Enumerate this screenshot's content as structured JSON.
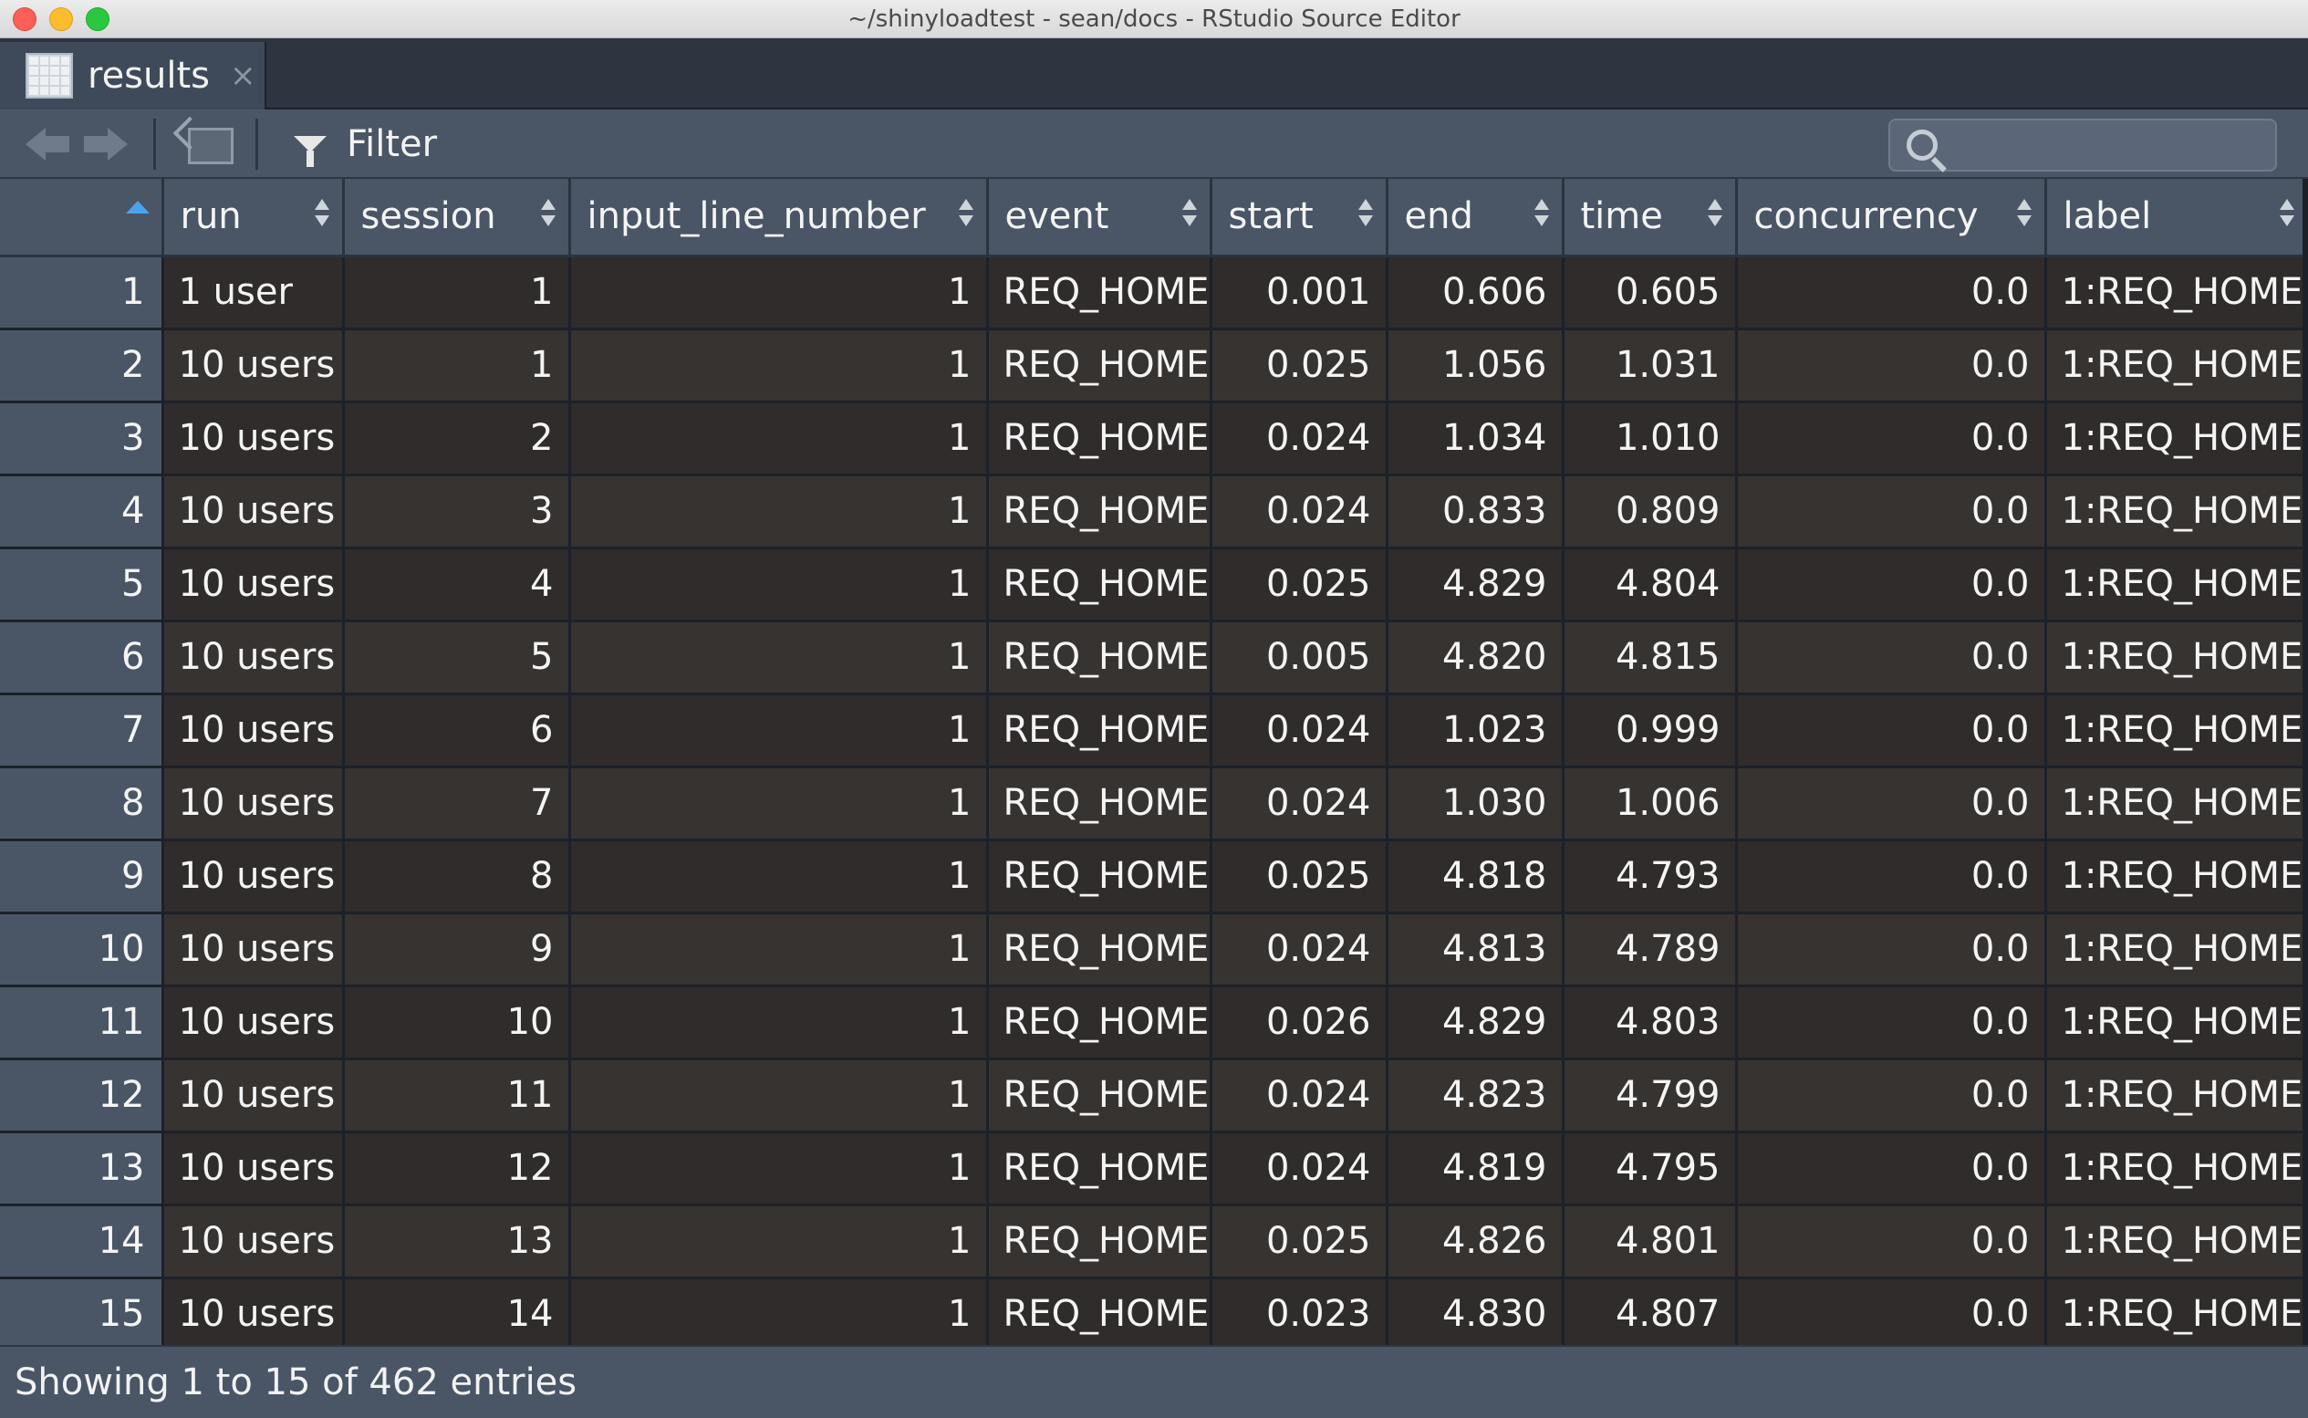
{
  "window": {
    "title": "~/shinyloadtest - sean/docs - RStudio Source Editor"
  },
  "tab": {
    "label": "results",
    "close": "×"
  },
  "toolbar": {
    "filter_label": "Filter",
    "search_placeholder": ""
  },
  "table": {
    "columns": [
      "run",
      "session",
      "input_line_number",
      "event",
      "start",
      "end",
      "time",
      "concurrency",
      "label"
    ],
    "rows": [
      [
        "1",
        "1 user",
        "1",
        "1",
        "REQ_HOME",
        "0.001",
        "0.606",
        "0.605",
        "0.0",
        "1:REQ_HOME"
      ],
      [
        "2",
        "10 users",
        "1",
        "1",
        "REQ_HOME",
        "0.025",
        "1.056",
        "1.031",
        "0.0",
        "1:REQ_HOME"
      ],
      [
        "3",
        "10 users",
        "2",
        "1",
        "REQ_HOME",
        "0.024",
        "1.034",
        "1.010",
        "0.0",
        "1:REQ_HOME"
      ],
      [
        "4",
        "10 users",
        "3",
        "1",
        "REQ_HOME",
        "0.024",
        "0.833",
        "0.809",
        "0.0",
        "1:REQ_HOME"
      ],
      [
        "5",
        "10 users",
        "4",
        "1",
        "REQ_HOME",
        "0.025",
        "4.829",
        "4.804",
        "0.0",
        "1:REQ_HOME"
      ],
      [
        "6",
        "10 users",
        "5",
        "1",
        "REQ_HOME",
        "0.005",
        "4.820",
        "4.815",
        "0.0",
        "1:REQ_HOME"
      ],
      [
        "7",
        "10 users",
        "6",
        "1",
        "REQ_HOME",
        "0.024",
        "1.023",
        "0.999",
        "0.0",
        "1:REQ_HOME"
      ],
      [
        "8",
        "10 users",
        "7",
        "1",
        "REQ_HOME",
        "0.024",
        "1.030",
        "1.006",
        "0.0",
        "1:REQ_HOME"
      ],
      [
        "9",
        "10 users",
        "8",
        "1",
        "REQ_HOME",
        "0.025",
        "4.818",
        "4.793",
        "0.0",
        "1:REQ_HOME"
      ],
      [
        "10",
        "10 users",
        "9",
        "1",
        "REQ_HOME",
        "0.024",
        "4.813",
        "4.789",
        "0.0",
        "1:REQ_HOME"
      ],
      [
        "11",
        "10 users",
        "10",
        "1",
        "REQ_HOME",
        "0.026",
        "4.829",
        "4.803",
        "0.0",
        "1:REQ_HOME"
      ],
      [
        "12",
        "10 users",
        "11",
        "1",
        "REQ_HOME",
        "0.024",
        "4.823",
        "4.799",
        "0.0",
        "1:REQ_HOME"
      ],
      [
        "13",
        "10 users",
        "12",
        "1",
        "REQ_HOME",
        "0.024",
        "4.819",
        "4.795",
        "0.0",
        "1:REQ_HOME"
      ],
      [
        "14",
        "10 users",
        "13",
        "1",
        "REQ_HOME",
        "0.025",
        "4.826",
        "4.801",
        "0.0",
        "1:REQ_HOME"
      ],
      [
        "15",
        "10 users",
        "14",
        "1",
        "REQ_HOME",
        "0.023",
        "4.830",
        "4.807",
        "0.0",
        "1:REQ_HOME"
      ]
    ]
  },
  "footer": {
    "status": "Showing 1 to 15 of 462 entries"
  },
  "colors": {
    "header_bg": "#4a5666",
    "cell_bg": "#2f2c2b",
    "sort_active": "#4aa3f0"
  },
  "icons": [
    "back-arrow-icon",
    "forward-arrow-icon",
    "popout-icon",
    "filter-icon",
    "search-icon",
    "grid-icon"
  ]
}
